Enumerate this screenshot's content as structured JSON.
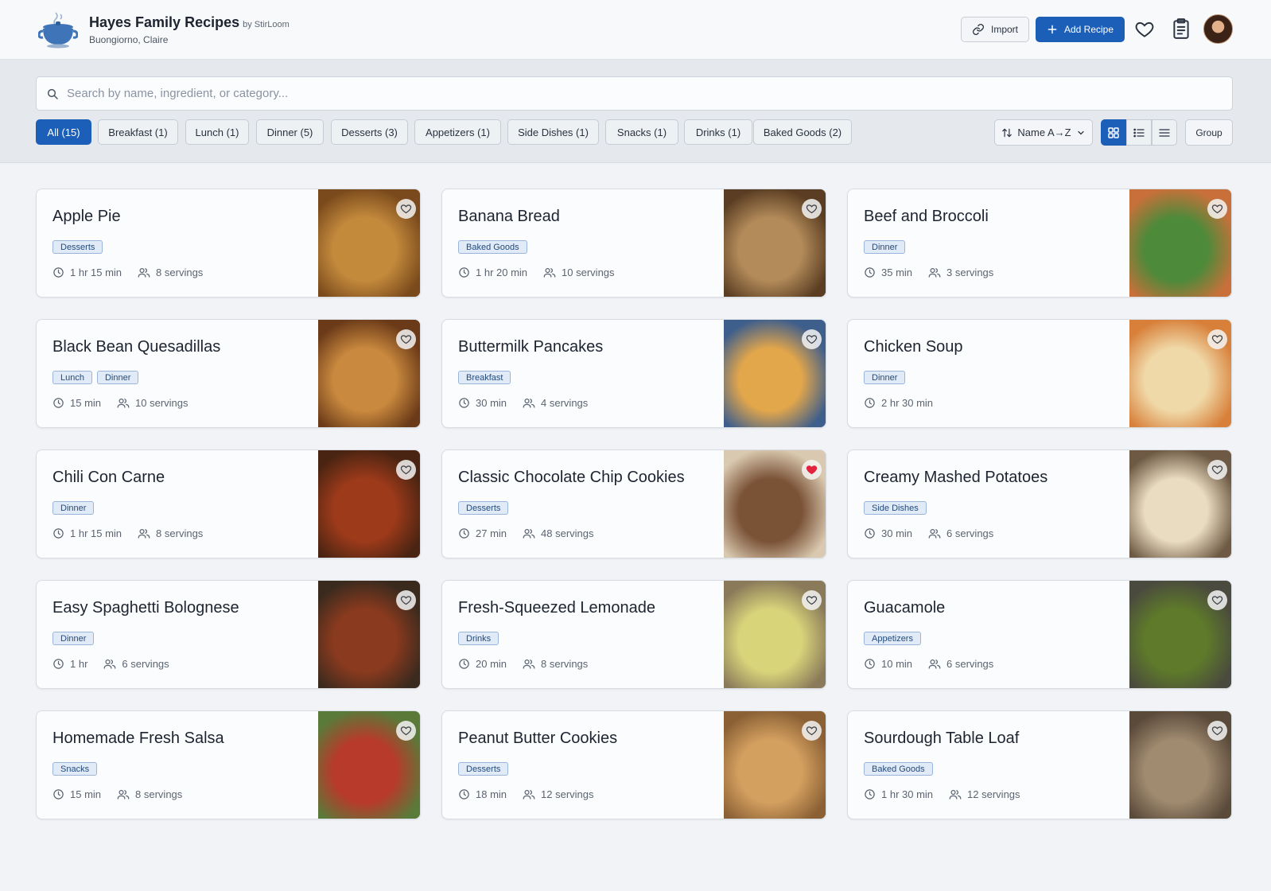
{
  "header": {
    "app_title": "Hayes Family Recipes",
    "by_line": "by StirLoom",
    "greeting": "Buongiorno, Claire",
    "import_label": "Import",
    "add_label": "Add Recipe"
  },
  "search": {
    "placeholder": "Search by name, ingredient, or category...",
    "value": ""
  },
  "categories": [
    {
      "label": "All (15)",
      "active": true
    },
    {
      "label": "Breakfast (1)"
    },
    {
      "label": "Lunch (1)"
    },
    {
      "label": "Dinner (5)"
    },
    {
      "label": "Desserts (3)"
    },
    {
      "label": "Appetizers (1)"
    },
    {
      "label": "Side Dishes (1)"
    },
    {
      "label": "Snacks (1)"
    },
    {
      "label": "Drinks (1)"
    },
    {
      "label": "Baked Goods (2)"
    }
  ],
  "sort": {
    "label": "Name A→Z"
  },
  "view": {
    "active": "grid"
  },
  "group_label": "Group",
  "colors": {
    "accent": "#1c5fb8",
    "favorite": "#e3223d"
  },
  "recipes": [
    {
      "title": "Apple Pie",
      "tags": [
        "Desserts"
      ],
      "time": "1 hr 15 min",
      "servings": "8 servings",
      "favorite": false
    },
    {
      "title": "Banana Bread",
      "tags": [
        "Baked Goods"
      ],
      "time": "1 hr 20 min",
      "servings": "10 servings",
      "favorite": false
    },
    {
      "title": "Beef and Broccoli",
      "tags": [
        "Dinner"
      ],
      "time": "35 min",
      "servings": "3 servings",
      "favorite": false
    },
    {
      "title": "Black Bean Quesadillas",
      "tags": [
        "Lunch",
        "Dinner"
      ],
      "time": "15 min",
      "servings": "10 servings",
      "favorite": false
    },
    {
      "title": "Buttermilk Pancakes",
      "tags": [
        "Breakfast"
      ],
      "time": "30 min",
      "servings": "4 servings",
      "favorite": false
    },
    {
      "title": "Chicken Soup",
      "tags": [
        "Dinner"
      ],
      "time": "2 hr 30 min",
      "servings": "",
      "favorite": false
    },
    {
      "title": "Chili Con Carne",
      "tags": [
        "Dinner"
      ],
      "time": "1 hr 15 min",
      "servings": "8 servings",
      "favorite": false
    },
    {
      "title": "Classic Chocolate Chip Cookies",
      "tags": [
        "Desserts"
      ],
      "time": "27 min",
      "servings": "48 servings",
      "favorite": true
    },
    {
      "title": "Creamy Mashed Potatoes",
      "tags": [
        "Side Dishes"
      ],
      "time": "30 min",
      "servings": "6 servings",
      "favorite": false
    },
    {
      "title": "Easy Spaghetti Bolognese",
      "tags": [
        "Dinner"
      ],
      "time": "1 hr",
      "servings": "6 servings",
      "favorite": false
    },
    {
      "title": "Fresh-Squeezed Lemonade",
      "tags": [
        "Drinks"
      ],
      "time": "20 min",
      "servings": "8 servings",
      "favorite": false
    },
    {
      "title": "Guacamole",
      "tags": [
        "Appetizers"
      ],
      "time": "10 min",
      "servings": "6 servings",
      "favorite": false
    },
    {
      "title": "Homemade Fresh Salsa",
      "tags": [
        "Snacks"
      ],
      "time": "15 min",
      "servings": "8 servings",
      "favorite": false
    },
    {
      "title": "Peanut Butter Cookies",
      "tags": [
        "Desserts"
      ],
      "time": "18 min",
      "servings": "12 servings",
      "favorite": false
    },
    {
      "title": "Sourdough Table Loaf",
      "tags": [
        "Baked Goods"
      ],
      "time": "1 hr 30 min",
      "servings": "12 servings",
      "favorite": false
    }
  ]
}
